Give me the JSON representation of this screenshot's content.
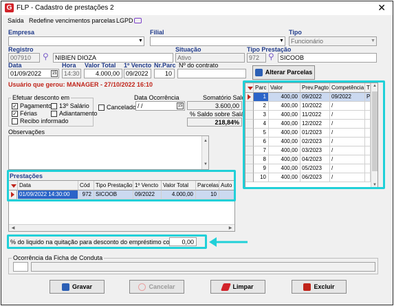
{
  "window": {
    "title": "FLP - Cadastro de prestações 2",
    "close_glyph": "✕",
    "app_icon_glyph": "G"
  },
  "menu": [
    "Saída",
    "Redefine vencimentos parcelas",
    "LGPD"
  ],
  "labels": {
    "empresa": "Empresa",
    "filial": "Filial",
    "tipo": "Tipo",
    "registro": "Registro",
    "situacao": "Situação",
    "tipo_prestacao": "Tipo Prestação",
    "data": "Data",
    "hora": "Hora",
    "valor_total": "Valor Total",
    "primeiro_vencto": "1º Vencto",
    "nr_parc": "Nr.Parc",
    "nr_contrato": "Nº do contrato",
    "usuario": "Usuário que gerou: MANAGER - 27/10/2022 16:10",
    "efetuar_desconto": "Efetuar desconto em",
    "pagamento": "Pagamento",
    "ferias": "Férias",
    "recibo": "Recibo informado",
    "decimo": "13º Salário",
    "adiantamento": "Adiantamento",
    "cancelado": "Cancelado",
    "data_ocorrencia": "Data Ocorrência",
    "somatorio": "Somatório Saldo",
    "pct_saldo": "% Saldo sobre Salário",
    "observacoes": "Observações",
    "prestacoes": "Prestações",
    "pct_liquido": "% do liquido na quitação para desconto do empréstimo consignado",
    "ocorrencia_ficha": "Ocorrência da Ficha de Conduta"
  },
  "fields": {
    "empresa": "",
    "filial": "",
    "tipo": "Funcionário",
    "registro_code": "007910",
    "registro_name": "NIBIEN DIOZA",
    "situacao": "Ativo",
    "tipo_prest_code": "972",
    "tipo_prest_name": "SICOOB",
    "data": "01/09/2022",
    "hora": "14:30",
    "valor_total": "4.000,00",
    "primeiro_vencto": "09/2022",
    "nr_parc": "10",
    "nr_contrato": "",
    "data_ocorrencia": "/ /",
    "somatorio": "3.600,00",
    "pct_saldo": "218,84%",
    "pct_liquido": "0,00",
    "ocorrencia_code": "",
    "ocorrencia_desc": ""
  },
  "checks": {
    "pagamento": true,
    "ferias": true,
    "recibo": false,
    "decimo": false,
    "adiantamento": false,
    "cancelado": false
  },
  "buttons": {
    "alterar": "Alterar Parcelas",
    "gravar": "Gravar",
    "cancelar": "Cancelar",
    "limpar": "Limpar",
    "excluir": "Excluir"
  },
  "parcelas": {
    "headers": [
      "Parc",
      "Valor",
      "Prev.Pagto",
      "Competência",
      "T"
    ],
    "rows": [
      [
        "1",
        "400,00",
        "09/2022",
        "09/2022",
        "P"
      ],
      [
        "2",
        "400,00",
        "10/2022",
        "/",
        ""
      ],
      [
        "3",
        "400,00",
        "11/2022",
        "/",
        ""
      ],
      [
        "4",
        "400,00",
        "12/2022",
        "/",
        ""
      ],
      [
        "5",
        "400,00",
        "01/2023",
        "/",
        ""
      ],
      [
        "6",
        "400,00",
        "02/2023",
        "/",
        ""
      ],
      [
        "7",
        "400,00",
        "03/2023",
        "/",
        ""
      ],
      [
        "8",
        "400,00",
        "04/2023",
        "/",
        ""
      ],
      [
        "9",
        "400,00",
        "05/2023",
        "/",
        ""
      ],
      [
        "10",
        "400,00",
        "06/2023",
        "/",
        ""
      ]
    ]
  },
  "prestacoes": {
    "headers": [
      "Data",
      "Cód",
      "Tipo Prestação",
      "1º Vencto",
      "Valor Total",
      "Parcelas",
      "Auto"
    ],
    "rows": [
      [
        "01/09/2022 14:30:00",
        "972",
        "SICOOB",
        "09/2022",
        "4.000,00",
        "10",
        ""
      ]
    ]
  },
  "colors": {
    "accent": "#1f3a8a",
    "highlight": "#20d0d8",
    "warning": "#c0241a"
  }
}
